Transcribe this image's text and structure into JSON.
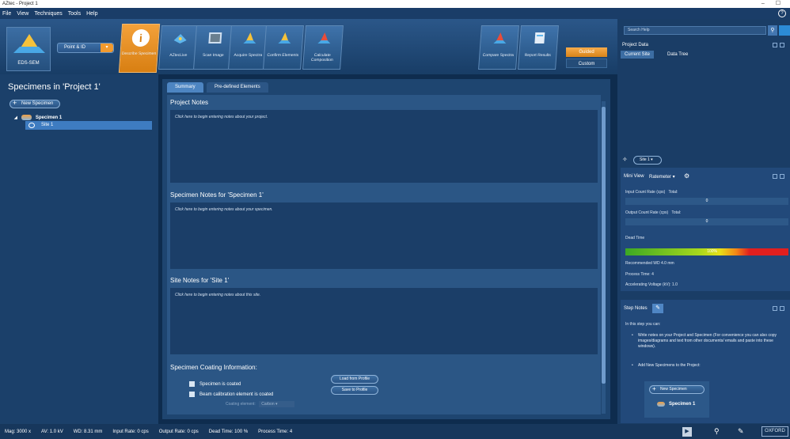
{
  "window": {
    "title": "AZtec - Project 1"
  },
  "menu": [
    "File",
    "View",
    "Techniques",
    "Tools",
    "Help"
  ],
  "ribbon": {
    "eds_label": "EDS-SEM",
    "mode_dropdown": "Point & ID",
    "steps": [
      {
        "label": "Describe Specimen",
        "active": true,
        "icon": "info-icon"
      },
      {
        "label": "AZtecLive",
        "active": false,
        "icon": "live-icon"
      },
      {
        "label": "Scan Image",
        "active": false,
        "icon": "image-icon"
      },
      {
        "label": "Acquire Spectra",
        "active": false,
        "icon": "spectrum-icon"
      },
      {
        "label": "Confirm Elements",
        "active": false,
        "icon": "spectrum-icon"
      },
      {
        "label": "Calculate Composition",
        "active": false,
        "icon": "composition-icon"
      }
    ],
    "compare_spectra": "Compare Spectra",
    "report_results": "Report Results",
    "guided": "Guided",
    "custom": "Custom"
  },
  "left_panel": {
    "title": "Specimens in 'Project 1'",
    "new_specimen": "New Specimen",
    "tree": {
      "specimen": "Specimen 1",
      "site": "Site 1"
    }
  },
  "center": {
    "tabs": [
      "Summary",
      "Pre-defined Elements"
    ],
    "project_notes_title": "Project Notes",
    "project_notes_placeholder": "Click here to begin entering notes about your project.",
    "specimen_notes_title": "Specimen Notes for 'Specimen 1'",
    "specimen_notes_placeholder": "Click here to begin entering notes about your specimen.",
    "site_notes_title": "Site Notes for 'Site 1'",
    "site_notes_placeholder": "Click here to begin entering notes about this site.",
    "coating_title": "Specimen Coating Information:",
    "specimen_coated": "Specimen is coated",
    "beam_calibration": "Beam calibration element is coated",
    "load_from_profile": "Load from Profile",
    "save_to_profile": "Save to Profile",
    "coating_element_label": "Coating element:",
    "coating_element_value": "Carbon"
  },
  "right_panel": {
    "search_placeholder": "Search Help",
    "project_data": "Project Data",
    "tabs": [
      "Current Site",
      "Data Tree"
    ],
    "site_selector": "Site 1",
    "mini_view": "Mini View",
    "ratemeter": "Ratemeter",
    "input_count_rate": "Input Count Rate (cps)",
    "input_total_label": "Total:",
    "input_total": "0",
    "output_count_rate": "Output Count Rate (cps)",
    "output_total_label": "Total:",
    "output_total": "0",
    "dead_time": "Dead Time",
    "dead_time_value": "100%",
    "recommended_wd": "Recommended WD 4.0 mm",
    "process_time": "Process Time: 4",
    "accelerating_voltage": "Accelerating Voltage (kV): 1.0",
    "step_notes": "Step Notes",
    "step_intro": "In this step you can:",
    "bullets": [
      "Write notes on your Project and Specimen (For convenience you can also copy images/diagrams and text from other documents/ emails and paste into these windows).",
      "Add New Specimens to the Project:"
    ],
    "mini_new_specimen": "New Specimen",
    "mini_specimen": "Specimen 1"
  },
  "status": {
    "mag": "Mag: 3000 x",
    "av": "AV: 1.0 kV",
    "wd": "WD: 8.31 mm",
    "input_rate": "Input Rate: 0 cps",
    "output_rate": "Output Rate: 0 cps",
    "dead_time": "Dead Time: 100 %",
    "process_time": "Process Time: 4",
    "brand": "OXFORD"
  },
  "colors": {
    "accent_orange": "#f29a2e",
    "background": "#0e2c4e"
  }
}
